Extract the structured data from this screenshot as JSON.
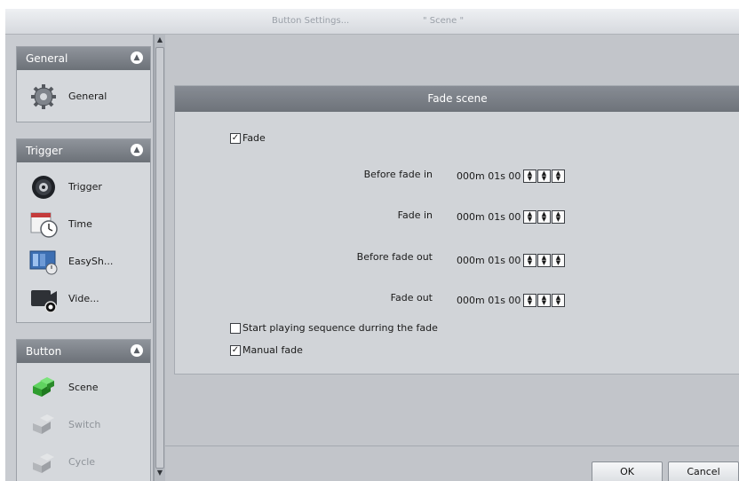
{
  "window": {
    "title": "Button  Settings...",
    "subtitle": "\" Scene \""
  },
  "sidebar": {
    "groups": [
      {
        "title": "General",
        "items": [
          {
            "label": "General",
            "icon": "gear-icon",
            "enabled": true
          }
        ]
      },
      {
        "title": "Trigger",
        "items": [
          {
            "label": "Trigger",
            "icon": "trigger-icon",
            "enabled": true
          },
          {
            "label": "Time",
            "icon": "clock-calendar-icon",
            "enabled": true
          },
          {
            "label": "EasySh...",
            "icon": "easyshow-icon",
            "enabled": true
          },
          {
            "label": "Vide...",
            "icon": "video-icon",
            "enabled": true
          }
        ]
      },
      {
        "title": "Button",
        "items": [
          {
            "label": "Scene",
            "icon": "scene-icon",
            "enabled": true
          },
          {
            "label": "Switch",
            "icon": "switch-icon",
            "enabled": false
          },
          {
            "label": "Cycle",
            "icon": "cycle-icon",
            "enabled": false
          }
        ]
      }
    ]
  },
  "fade_panel": {
    "title": "Fade scene",
    "fade_checkbox": {
      "label": "Fade",
      "checked": true
    },
    "rows": [
      {
        "label": "Before fade in",
        "value": "000m 01s 00"
      },
      {
        "label": "Fade in",
        "value": "000m 01s 00"
      },
      {
        "label": "Before fade out",
        "value": "000m 01s 00"
      },
      {
        "label": "Fade out",
        "value": "000m 01s 00"
      }
    ],
    "start_playing_checkbox": {
      "label": "Start playing sequence durring the fade",
      "checked": false
    },
    "manual_fade_checkbox": {
      "label": "Manual fade",
      "checked": true
    }
  },
  "buttons": {
    "ok": "OK",
    "cancel": "Cancel"
  },
  "colors": {
    "panel_header": "#787d84",
    "background": "#c2c5ca",
    "scene_icon": "#2fae2f"
  }
}
